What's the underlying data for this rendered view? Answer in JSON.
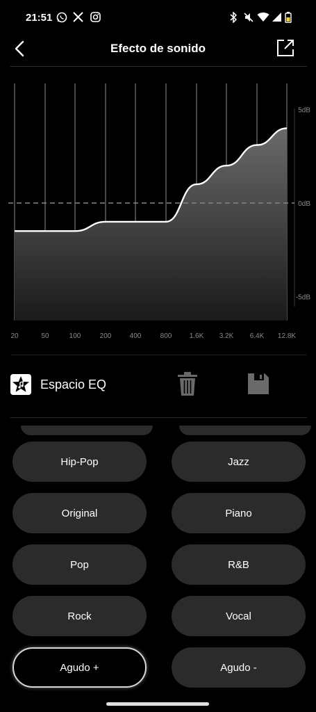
{
  "status_bar": {
    "time": "21:51",
    "icons": [
      "whatsapp-icon",
      "x-icon",
      "instagram-icon",
      "bluetooth-icon",
      "mute-icon",
      "wifi-icon",
      "signal-icon",
      "battery-icon"
    ]
  },
  "app_bar": {
    "title": "Efecto de sonido",
    "back_icon": "back-icon",
    "share_icon": "share-icon"
  },
  "chart_data": {
    "type": "area",
    "x": [
      "20",
      "50",
      "100",
      "200",
      "400",
      "800",
      "1.6K",
      "3.2K",
      "6.4K",
      "12.8K"
    ],
    "series": [
      {
        "values": [
          -1.5,
          -1.5,
          -1.5,
          -1.0,
          -1.0,
          -1.0,
          1.0,
          2.0,
          3.1,
          4.0
        ]
      }
    ],
    "y_ticks": [
      "5dB",
      "0dB",
      "-5dB"
    ],
    "ylim": [
      -5,
      5
    ],
    "zero_line": "dashed",
    "grid": true,
    "fill_color": "#5a5a5a",
    "line_color": "#ffffff"
  },
  "eq_space": {
    "label": "Espacio EQ",
    "logo_icon": "music-star-icon",
    "delete_icon": "trash-icon",
    "save_icon": "floppy-save-icon"
  },
  "presets": [
    {
      "label": "Hip-Pop",
      "selected": false
    },
    {
      "label": "Jazz",
      "selected": false
    },
    {
      "label": "Original",
      "selected": false
    },
    {
      "label": "Piano",
      "selected": false
    },
    {
      "label": "Pop",
      "selected": false
    },
    {
      "label": "R&B",
      "selected": false
    },
    {
      "label": "Rock",
      "selected": false
    },
    {
      "label": "Vocal",
      "selected": false
    },
    {
      "label": "Agudo +",
      "selected": true
    },
    {
      "label": "Agudo -",
      "selected": false
    }
  ]
}
